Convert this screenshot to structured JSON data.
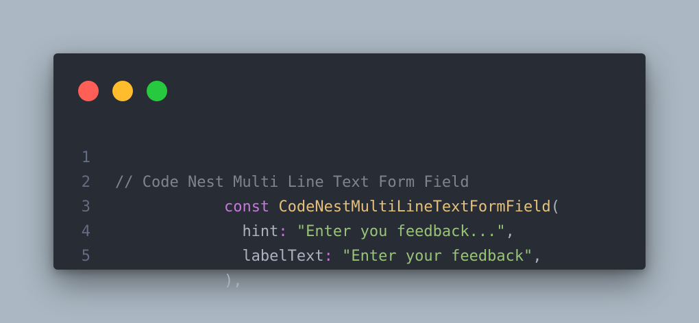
{
  "window": {
    "controls": {
      "close_color": "#ff5f56",
      "minimize_color": "#ffbd2e",
      "maximize_color": "#27c93f"
    }
  },
  "code": {
    "lines": [
      {
        "number": "1",
        "indent": "",
        "comment": "// Code Nest Multi Line Text Form Field"
      },
      {
        "number": "2",
        "indent": "            ",
        "keyword": "const",
        "space": " ",
        "function": "CodeNestMultiLineTextFormField",
        "open_paren": "("
      },
      {
        "number": "3",
        "indent": "              ",
        "prop": "hint",
        "colon": ":",
        "space": " ",
        "string": "\"Enter you feedback...\"",
        "comma": ","
      },
      {
        "number": "4",
        "indent": "              ",
        "prop": "labelText",
        "colon": ":",
        "space": " ",
        "string": "\"Enter your feedback\"",
        "comma": ","
      },
      {
        "number": "5",
        "indent": "            ",
        "close": "),"
      }
    ]
  }
}
